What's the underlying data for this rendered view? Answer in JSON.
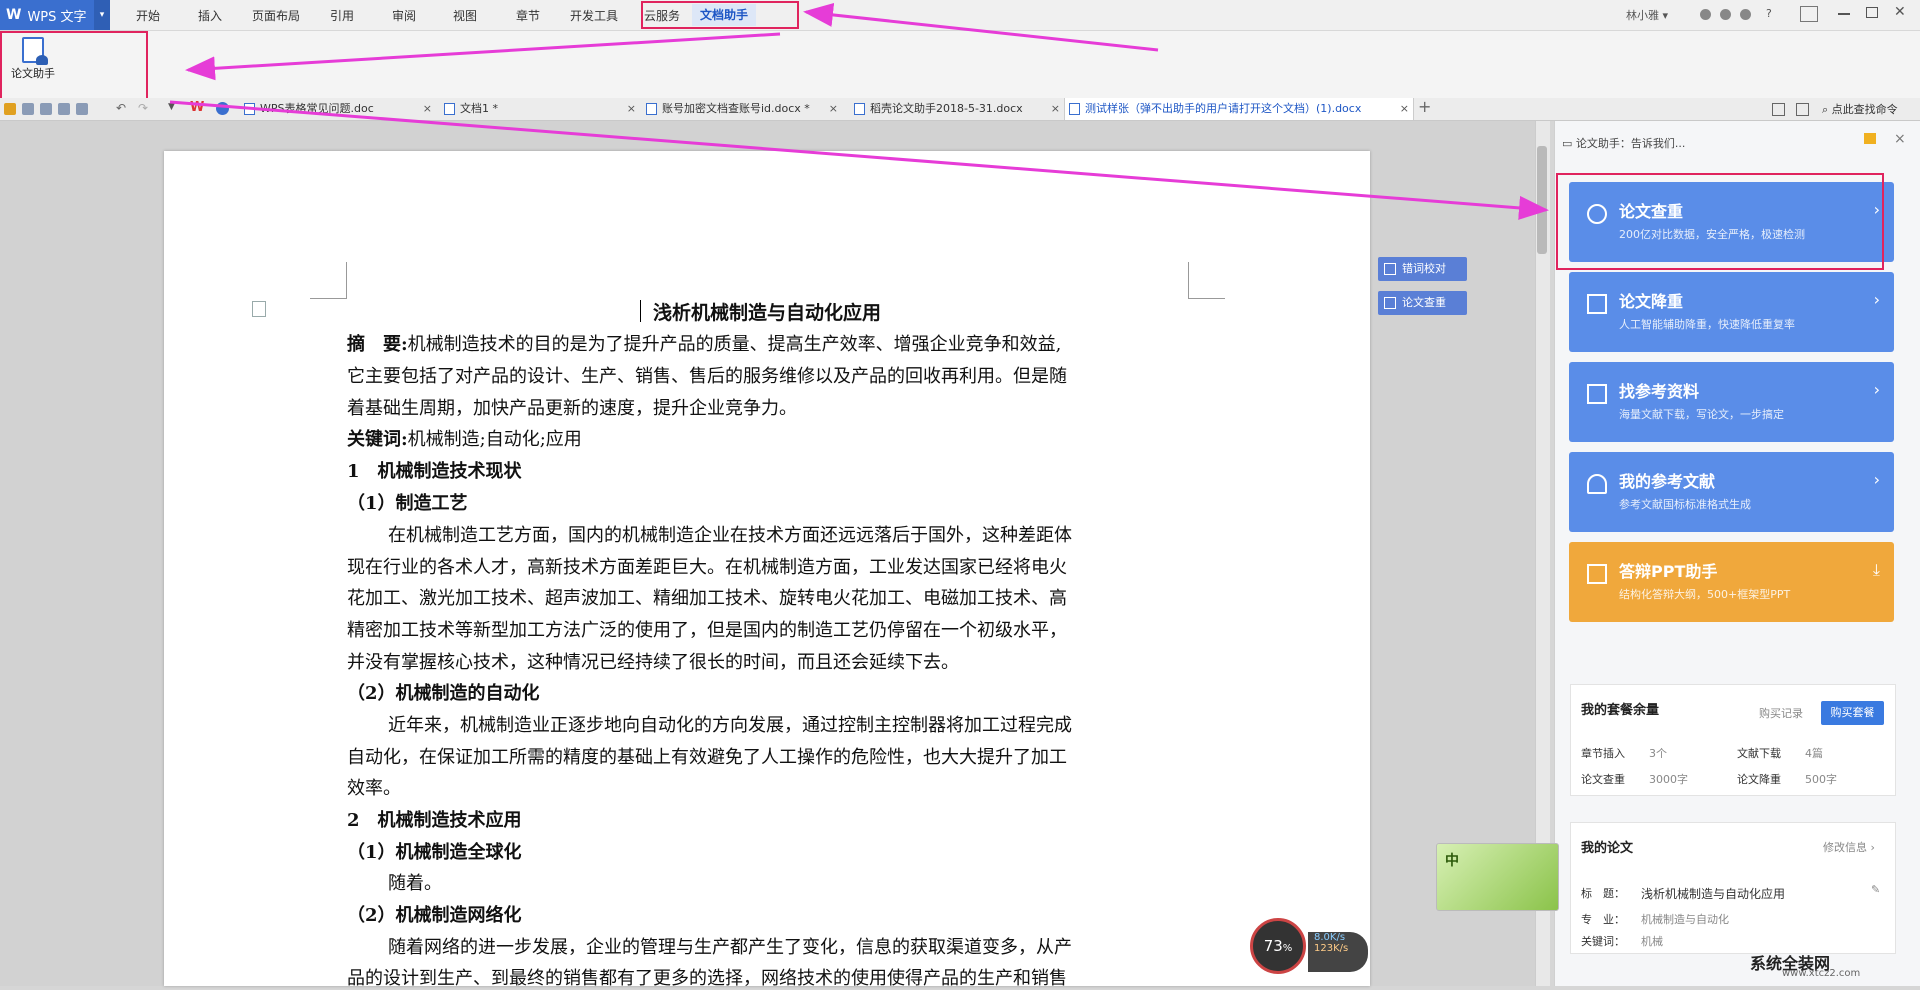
{
  "colors": {
    "accent": "#3a6fcf",
    "annotation": "#e0245e",
    "feature_blue": "#5a8de8",
    "feature_orange": "#f0a83c"
  },
  "app": {
    "logo": "W",
    "name": "WPS 文字",
    "dropdown": "▾"
  },
  "menu": [
    "开始",
    "插入",
    "页面布局",
    "引用",
    "审阅",
    "视图",
    "章节",
    "开发工具",
    "云服务",
    "文档助手"
  ],
  "top_right": {
    "user": "林小雅",
    "help": "?"
  },
  "ribbon": {
    "thesis_button": "论文助手"
  },
  "doc_tabs": [
    {
      "label": "WPS表格常见问题.doc",
      "close": "×"
    },
    {
      "label": "文档1 *",
      "close": "×"
    },
    {
      "label": "账号加密文档查账号id.docx *",
      "close": "×"
    },
    {
      "label": "稻壳论文助手2018-5-31.docx",
      "close": "×"
    },
    {
      "label": "测试样张（弹不出助手的用户请打开这个文档）(1).docx",
      "close": "×"
    }
  ],
  "new_tab": "+",
  "search_cmd": "点此查找命令",
  "document": {
    "title": "浅析机械制造与自动化应用",
    "abstract_label": "摘　要:",
    "abstract_1": "机械制造技术的目的是为了提升产品的质量、提高生产效率、增强企业竞争和效益,",
    "abstract_2": "它主要包括了对产品的设计、生产、销售、售后的服务维修以及产品的回收再利用。但是随",
    "abstract_3": "着基础生周期，加快产品更新的速度，提升企业竞争力。",
    "keywords_label": "关键词:",
    "keywords": "机械制造;自动化;应用",
    "h1": "1　机械制造技术现状",
    "h1_1": "（1）制造工艺",
    "p1_1": "在机械制造工艺方面，国内的机械制造企业在技术方面还远远落后于国外，这种差距体",
    "p1_2": "现在行业的各术人才，高新技术方面差距巨大。在机械制造方面，工业发达国家已经将电火",
    "p1_3": "花加工、激光加工技术、超声波加工、精细加工技术、旋转电火花加工、电磁加工技术、高",
    "p1_4": "精密加工技术等新型加工方法广泛的使用了，但是国内的制造工艺仍停留在一个初级水平，",
    "p1_5": "并没有掌握核心技术，这种情况已经持续了很长的时间，而且还会延续下去。",
    "h1_2": "（2）机械制造的自动化",
    "p2_1": "近年来，机械制造业正逐步地向自动化的方向发展，通过控制主控制器将加工过程完成",
    "p2_2": "自动化，在保证加工所需的精度的基础上有效避免了人工操作的危险性，也大大提升了加工",
    "p2_3": "效率。",
    "h2": "2　机械制造技术应用",
    "h2_1": "（1）机械制造全球化",
    "p3_1": "随着。",
    "h2_2": "（2）机械制造网络化",
    "p4_1": "随着网络的进一步发展，企业的管理与生产都产生了变化，信息的获取渠道变多，从产",
    "p4_2": "品的设计到生产、到最终的销售都有了更多的选择，网络技术的使用使得产品的生产和销售"
  },
  "side_tools": {
    "typo": "错词校对",
    "check": "论文查重"
  },
  "panel": {
    "header": "论文助手：告诉我们...",
    "close": "×",
    "features": [
      {
        "title": "论文查重",
        "sub": "200亿对比数据，安全严格，极速检测",
        "arrow": "›",
        "icon": "search-icon"
      },
      {
        "title": "论文降重",
        "sub": "人工智能辅助降重，快速降低重复率",
        "arrow": "›",
        "icon": "list-icon"
      },
      {
        "title": "找参考资料",
        "sub": "海量文献下载，写论文，一步搞定",
        "arrow": "›",
        "icon": "book-icon"
      },
      {
        "title": "我的参考文献",
        "sub": "参考文献国标标准格式生成",
        "arrow": "›",
        "icon": "user-icon"
      },
      {
        "title": "答辩PPT助手",
        "sub": "结构化答辩大纲，500+框架型PPT",
        "arrow": "⤓",
        "icon": "ppt-icon"
      }
    ],
    "package": {
      "title": "我的套餐余量",
      "history": "购买记录",
      "buy": "购买套餐",
      "items": [
        {
          "label": "章节插入",
          "value": "3个"
        },
        {
          "label": "文献下载",
          "value": "4篇"
        },
        {
          "label": "论文查重",
          "value": "3000字"
        },
        {
          "label": "论文降重",
          "value": "500字"
        }
      ]
    },
    "my_thesis": {
      "title": "我的论文",
      "edit": "修改信息 ›",
      "title_label": "标　题：",
      "title_value": "浅析机械制造与自动化应用",
      "major_label": "专　业：",
      "major_value": "机械制造与自动化",
      "kw_label": "关键词：",
      "kw_value": "机械"
    }
  },
  "widgets": {
    "ime": "中",
    "gauge_percent": "73",
    "gauge_unit": "%",
    "up_speed": "8.0K/s",
    "down_speed": "123K/s",
    "watermark": "系统全装网",
    "watermark_url": "www.xtcz2.com"
  }
}
